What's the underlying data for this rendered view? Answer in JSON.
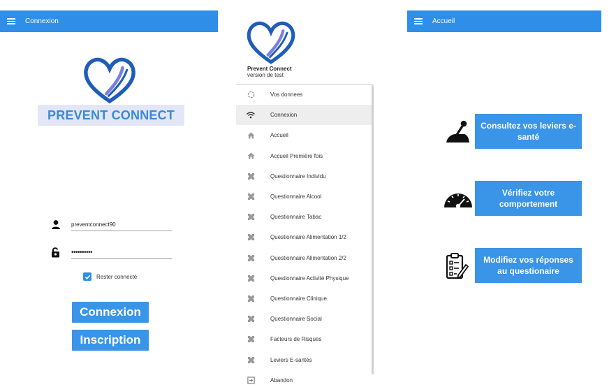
{
  "colors": {
    "accent": "#2f8fe8",
    "button": "#3a94e8",
    "brand_text": "#3a8ad6",
    "brand_bg": "#e3e6f7",
    "heart_dark": "#1f5db8",
    "heart_light": "#7a7fe6"
  },
  "login_screen": {
    "topbar_title": "Connexion",
    "brand": "PREVENT CONNECT",
    "username_value": "preventconnect90",
    "password_value": "••••••••••",
    "remember_label": "Rester connecté",
    "remember_checked": true,
    "login_button": "Connexion",
    "signup_button": "Inscription"
  },
  "drawer": {
    "app_name": "Prevent Connect",
    "version": "version de test",
    "items": [
      {
        "label": "Vos donnees",
        "icon": "loading-circle-icon"
      },
      {
        "label": "Connexion",
        "icon": "wifi-icon",
        "active": true
      },
      {
        "label": "Accueil",
        "icon": "home-icon"
      },
      {
        "label": "Accueil Première fois",
        "icon": "home-icon"
      },
      {
        "label": "Questionnaire Individu",
        "icon": "puzzle-icon"
      },
      {
        "label": "Questionnaire Alcool",
        "icon": "puzzle-icon"
      },
      {
        "label": "Questionnaire Tabac",
        "icon": "puzzle-icon"
      },
      {
        "label": "Questionnaire Alimentation 1/2",
        "icon": "puzzle-icon"
      },
      {
        "label": "Questionnaire Alimentation 2/2",
        "icon": "puzzle-icon"
      },
      {
        "label": "Questionnaire Activité Physique",
        "icon": "puzzle-icon"
      },
      {
        "label": "Questionnaire Clinique",
        "icon": "puzzle-icon"
      },
      {
        "label": "Questionnaire Social",
        "icon": "puzzle-icon"
      },
      {
        "label": "Facteurs de Risques",
        "icon": "puzzle-icon"
      },
      {
        "label": "Leviers E-santés",
        "icon": "puzzle-icon"
      },
      {
        "label": "Abandon",
        "icon": "exit-icon"
      }
    ]
  },
  "home_screen": {
    "topbar_title": "Accueil",
    "buttons": [
      {
        "label": "Consultez vos leviers e-santé",
        "icon": "joystick-lever-icon"
      },
      {
        "label": "Vérifiez votre comportement",
        "icon": "speedometer-icon"
      },
      {
        "label": "Modifiez vos réponses au questionaire",
        "icon": "clipboard-edit-icon"
      }
    ]
  }
}
